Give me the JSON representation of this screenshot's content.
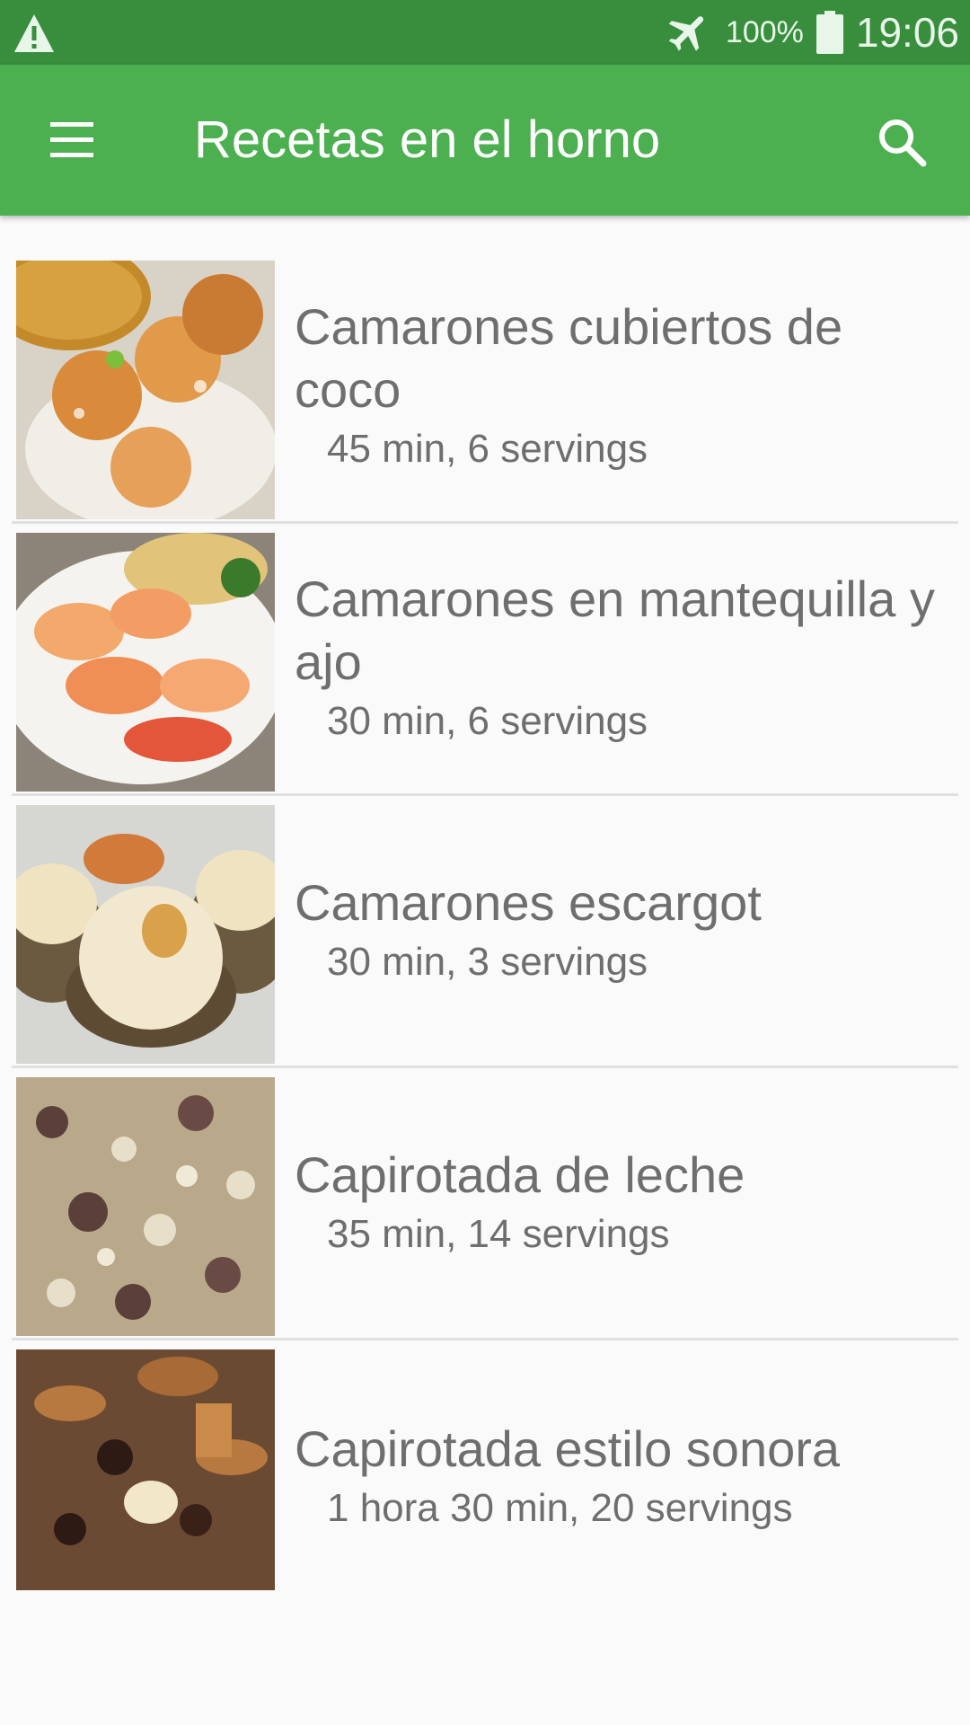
{
  "status_bar": {
    "battery": "100%",
    "time": "19:06",
    "icons": [
      "warning-icon",
      "airplane-mode-icon",
      "battery-icon"
    ]
  },
  "app_bar": {
    "title": "Recetas en el horno",
    "icons": [
      "menu-icon",
      "search-icon"
    ]
  },
  "colors": {
    "status_bar": "#388e3c",
    "app_bar": "#4caf50",
    "text": "#6e6e6e",
    "divider": "#e0e0e0"
  },
  "recipes": [
    {
      "title": "Camarones cubiertos de coco",
      "meta": "45 min, 6 servings"
    },
    {
      "title": "Camarones en mantequilla y ajo",
      "meta": "30 min, 6 servings"
    },
    {
      "title": "Camarones escargot",
      "meta": "30 min, 3 servings"
    },
    {
      "title": "Capirotada de leche",
      "meta": "35 min, 14 servings"
    },
    {
      "title": "Capirotada estilo sonora",
      "meta": "1 hora 30 min, 20 servings"
    }
  ]
}
